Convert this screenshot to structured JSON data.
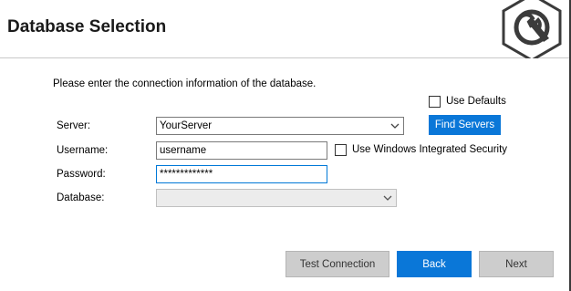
{
  "header": {
    "title": "Database Selection",
    "logo_icon": "wrench-gear-icon"
  },
  "form": {
    "intro": "Please enter the connection information of the database.",
    "use_defaults_label": "Use Defaults",
    "server_label": "Server:",
    "server_value": "YourServer",
    "find_servers_label": "Find Servers",
    "username_label": "Username:",
    "username_value": "username",
    "windows_security_label": "Use Windows Integrated Security",
    "password_label": "Password:",
    "password_value": "*************",
    "database_label": "Database:",
    "database_value": ""
  },
  "buttons": {
    "test_connection": "Test Connection",
    "back": "Back",
    "next": "Next"
  },
  "colors": {
    "accent": "#0a77d8",
    "disabled_button": "#cdcdcd"
  }
}
